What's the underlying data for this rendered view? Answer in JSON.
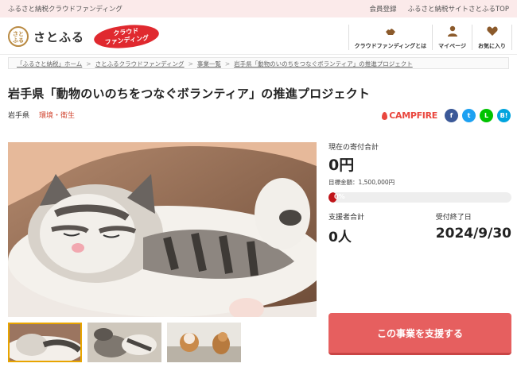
{
  "topbar": {
    "tagline": "ふるさと納税クラウドファンディング",
    "links": [
      "会員登録",
      "ふるさと納税サイトさとふるTOP"
    ]
  },
  "header": {
    "logo_mark": "さと\nふる",
    "logo_text": "さとふる",
    "badge_line1": "クラウド",
    "badge_line2": "ファンディング",
    "nav": [
      {
        "label": "クラウドファンディングとは",
        "icon": "hands-icon"
      },
      {
        "label": "マイページ",
        "icon": "user-icon"
      },
      {
        "label": "お気に入り",
        "icon": "heart-icon"
      }
    ]
  },
  "breadcrumb": [
    "「ふるさと納税」ホーム",
    "さとふるクラウドファンディング",
    "事業一覧",
    "岩手県「動物のいのちをつなぐボランティア」の推進プロジェクト"
  ],
  "breadcrumb_sep": ">",
  "project": {
    "title": "岩手県「動物のいのちをつなぐボランティア」の推進プロジェクト",
    "prefecture": "岩手県",
    "category": "環境・衛生"
  },
  "share": {
    "campfire": "CAMPFIRE",
    "facebook": "f",
    "twitter": "t",
    "line": "L",
    "hatena": "B!"
  },
  "stats": {
    "current_label": "現在の寄付合計",
    "current_amount": "0円",
    "goal_text": "目標金額：1,500,000円",
    "progress_text": "0%",
    "progress_value": 0,
    "supporters_label": "支援者合計",
    "supporters_value": "0人",
    "deadline_label": "受付終了日",
    "deadline_value": "2024/9/30"
  },
  "cta": {
    "label": "この事業を支援する"
  },
  "colors": {
    "accent": "#e65f5f",
    "brand_red": "#e0292f",
    "category": "#d0432e",
    "topbar_bg": "#fbeaea",
    "progress": "#c0151a"
  }
}
